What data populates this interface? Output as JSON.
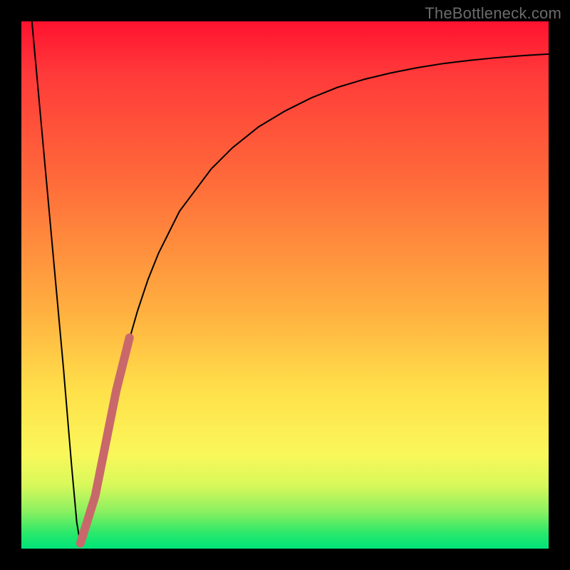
{
  "watermark": "TheBottleneck.com",
  "chart_data": {
    "type": "line",
    "title": "",
    "xlabel": "",
    "ylabel": "",
    "xlim": [
      0,
      100
    ],
    "ylim": [
      0,
      100
    ],
    "grid": false,
    "legend": false,
    "series": [
      {
        "name": "black-curve",
        "color": "#000000",
        "stroke_width": 2,
        "x": [
          2,
          4,
          6,
          8,
          9.5,
          10.5,
          11,
          11.5,
          12,
          13,
          14,
          16,
          18,
          20,
          22,
          24,
          26,
          28,
          30,
          33,
          36,
          40,
          45,
          50,
          55,
          60,
          65,
          70,
          75,
          80,
          85,
          90,
          95,
          100
        ],
        "y": [
          100,
          78,
          56,
          34,
          16,
          5,
          2,
          1,
          2,
          6,
          10,
          20,
          30,
          38,
          45,
          51,
          56,
          60,
          64,
          68,
          72,
          76,
          80,
          83,
          85.5,
          87.5,
          89,
          90.2,
          91.2,
          92,
          92.6,
          93.1,
          93.5,
          93.8
        ]
      },
      {
        "name": "highlight-segment",
        "color": "#c9686b",
        "stroke_width": 12,
        "linecap": "round",
        "x": [
          11.2,
          14.0,
          18.0,
          20.5
        ],
        "y": [
          1.0,
          10.0,
          30.0,
          40.0
        ]
      }
    ]
  }
}
